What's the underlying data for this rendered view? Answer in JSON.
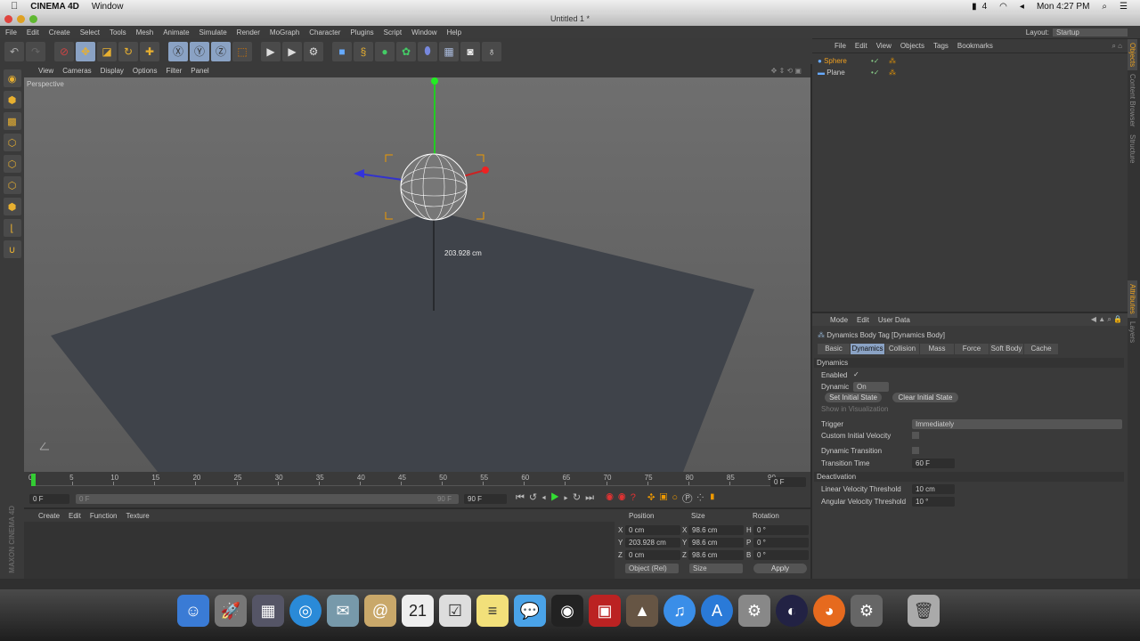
{
  "mac_menubar": {
    "app": "CINEMA 4D",
    "menu": "Window",
    "clock": "Mon 4:27 PM",
    "battery_label": "4"
  },
  "window": {
    "title": "Untitled 1 *",
    "layout_label": "Layout:",
    "layout_value": "Startup"
  },
  "main_menu": [
    "File",
    "Edit",
    "Create",
    "Select",
    "Tools",
    "Mesh",
    "Animate",
    "Simulate",
    "Render",
    "MoGraph",
    "Character",
    "Plugins",
    "Script",
    "Window",
    "Help"
  ],
  "toolbar_icons": [
    "undo-icon",
    "redo-icon",
    "live-selection-icon",
    "move-icon",
    "scale-icon",
    "rotate-icon",
    "recent-tool-icon",
    "x-axis-icon",
    "y-axis-icon",
    "z-axis-icon",
    "coordinate-system-icon",
    "render-view-icon",
    "render-picture-viewer-icon",
    "render-settings-icon",
    "cube-icon",
    "spline-icon",
    "nurbs-icon",
    "array-icon",
    "deformer-icon",
    "floor-icon",
    "camera-icon",
    "light-icon"
  ],
  "viewport": {
    "menu": [
      "View",
      "Cameras",
      "Display",
      "Options",
      "Filter",
      "Panel"
    ],
    "label": "Perspective",
    "measure": "203.928 cm"
  },
  "timeline": {
    "ticks": [
      "0",
      "5",
      "10",
      "15",
      "20",
      "25",
      "30",
      "35",
      "40",
      "45",
      "50",
      "55",
      "60",
      "65",
      "70",
      "75",
      "80",
      "85",
      "90"
    ],
    "current_frame": "0 F",
    "start": "0 F",
    "range_start": "0 F",
    "range_end": "90 F",
    "end": "90 F",
    "playhead_fraction": 0
  },
  "material_manager": {
    "menu": [
      "Create",
      "Edit",
      "Function",
      "Texture"
    ]
  },
  "coordinates": {
    "headers": [
      "Position",
      "Size",
      "Rotation"
    ],
    "rows": [
      {
        "axis": "X",
        "pos": "0 cm",
        "saxis": "X",
        "size": "98.6 cm",
        "raxis": "H",
        "rot": "0 °"
      },
      {
        "axis": "Y",
        "pos": "203.928 cm",
        "saxis": "Y",
        "size": "98.6 cm",
        "raxis": "P",
        "rot": "0 °"
      },
      {
        "axis": "Z",
        "pos": "0 cm",
        "saxis": "Z",
        "size": "98.6 cm",
        "raxis": "B",
        "rot": "0 °"
      }
    ],
    "mode": "Object (Rel)",
    "size_mode": "Size",
    "apply": "Apply"
  },
  "object_manager": {
    "menu": [
      "File",
      "Edit",
      "View",
      "Objects",
      "Tags",
      "Bookmarks"
    ],
    "objects": [
      {
        "name": "Sphere",
        "selected": true
      },
      {
        "name": "Plane",
        "selected": false
      }
    ]
  },
  "attributes": {
    "menu": [
      "Mode",
      "Edit",
      "User Data"
    ],
    "title": "Dynamics Body Tag [Dynamics Body]",
    "tabs": [
      "Basic",
      "Dynamics",
      "Collision",
      "Mass",
      "Force",
      "Soft Body",
      "Cache"
    ],
    "active_tab": "Dynamics",
    "section1": "Dynamics",
    "enabled_label": "Enabled",
    "dynamic_label": "Dynamic",
    "dynamic_value": "On",
    "set_initial": "Set Initial State",
    "clear_initial": "Clear Initial State",
    "show_vis": "Show in Visualization",
    "trigger_label": "Trigger",
    "trigger_value": "Immediately",
    "civ_label": "Custom Initial Velocity",
    "dt_label": "Dynamic Transition",
    "tt_label": "Transition Time",
    "tt_value": "60 F",
    "section2": "Deactivation",
    "lvt_label": "Linear Velocity Threshold",
    "lvt_value": "10 cm",
    "avt_label": "Angular Velocity Threshold",
    "avt_value": "10 °"
  },
  "side_tabs": {
    "right_top": [
      "Objects",
      "Content Browser",
      "Structure"
    ],
    "right_bottom": [
      "Attributes",
      "Layers"
    ]
  },
  "brand": "MAXON CINEMA 4D"
}
